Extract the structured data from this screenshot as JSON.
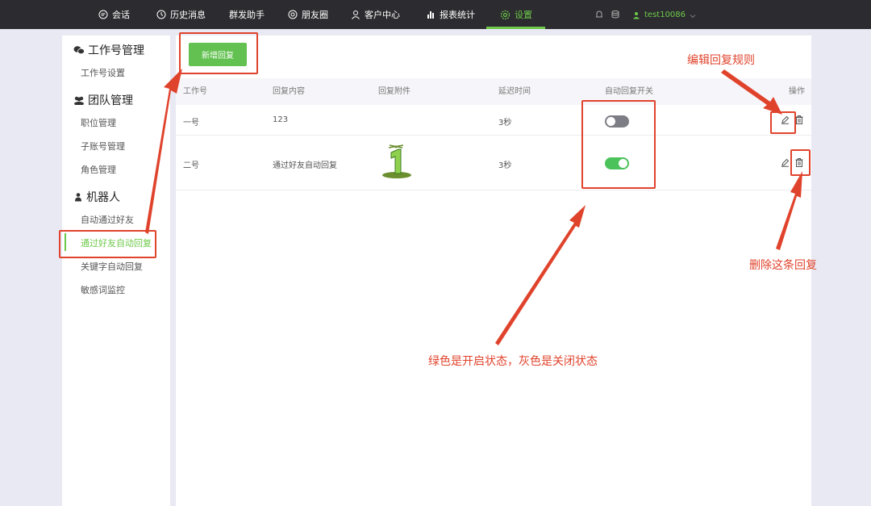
{
  "nav": {
    "items": [
      {
        "label": "会话",
        "icon": "chat-bubble-icon"
      },
      {
        "label": "历史消息",
        "icon": "clock-icon"
      },
      {
        "label": "群发助手",
        "icon": ""
      },
      {
        "label": "朋友圈",
        "icon": "aperture-icon"
      },
      {
        "label": "客户中心",
        "icon": "person-icon"
      },
      {
        "label": "报表统计",
        "icon": "bar-chart-icon"
      },
      {
        "label": "设置",
        "icon": "gear-icon",
        "active": true
      }
    ],
    "user": "test10086",
    "accent": "#6dc949"
  },
  "sidebar": {
    "groups": [
      {
        "title": "工作号管理",
        "icon": "wechat-icon",
        "items": [
          "工作号设置"
        ]
      },
      {
        "title": "团队管理",
        "icon": "team-icon",
        "items": [
          "职位管理",
          "子账号管理",
          "角色管理"
        ]
      },
      {
        "title": "机器人",
        "icon": "robot-icon",
        "items": [
          "自动通过好友",
          "通过好友自动回复",
          "关键字自动回复",
          "敏感词监控"
        ]
      }
    ],
    "active_item": "通过好友自动回复"
  },
  "main": {
    "add_button": "新增回复",
    "columns": [
      "工作号",
      "回复内容",
      "回复附件",
      "延迟时间",
      "自动回复开关",
      "操作"
    ],
    "rows": [
      {
        "account": "一号",
        "content": "123",
        "attachment": "",
        "delay": "3秒",
        "enabled": false
      },
      {
        "account": "二号",
        "content": "通过好友自动回复",
        "attachment": "number-one-sticker",
        "delay": "3秒",
        "enabled": true
      }
    ]
  },
  "annotations": {
    "edit_note": "编辑回复规则",
    "delete_note": "删除这条回复",
    "toggle_note": "绿色是开启状态，灰色是关闭状态",
    "color": "#e0432c"
  }
}
